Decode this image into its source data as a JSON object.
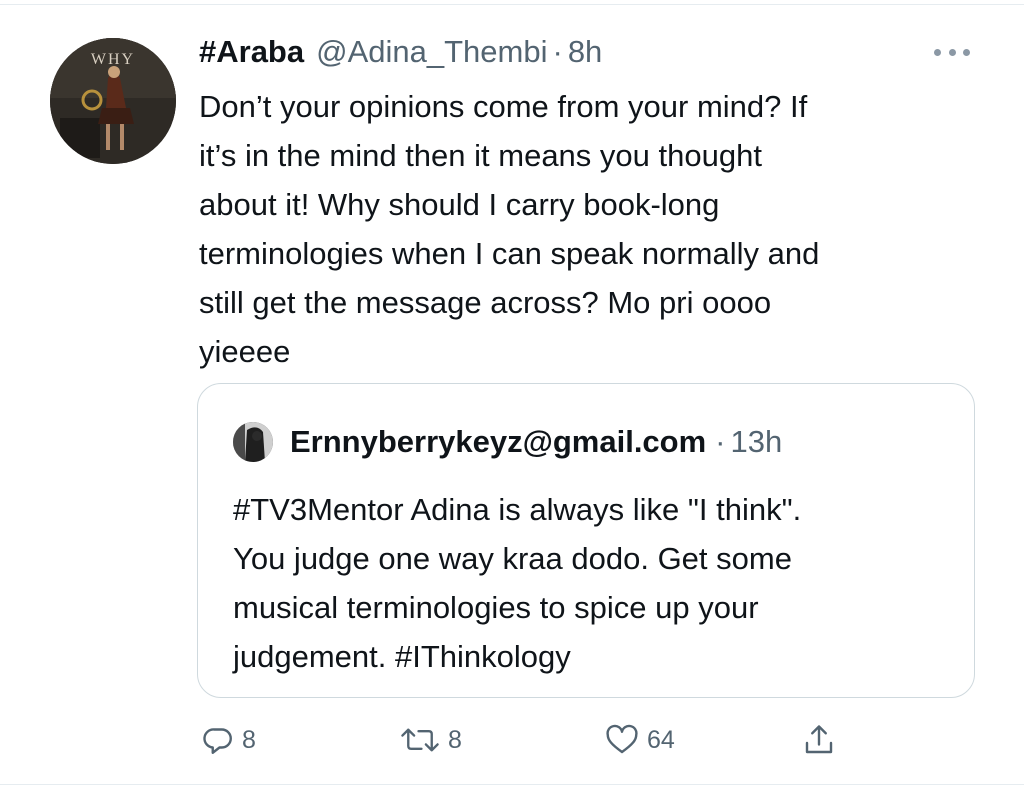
{
  "tweet": {
    "display_name": "#Araba",
    "handle": "@Adina_Thembi",
    "separator": "·",
    "time": "8h",
    "more_icon": "more-horizontal-icon",
    "avatar_text": "WHY",
    "text_lines": [
      "Don’t your opinions come from your mind? If",
      "it’s in the mind then it means you thought",
      "about it! Why should I carry book-long",
      "terminologies when I can speak normally and",
      "still get the message across? Mo pri oooo",
      "yieeee"
    ]
  },
  "quoted_tweet": {
    "display_name": "Ernnyberrykeyz@gmail.com",
    "separator": "·",
    "time": "13h",
    "text_lines": [
      "#TV3Mentor Adina is always like \"I think\".",
      "You judge one way kraa dodo. Get some",
      "musical terminologies to spice up your",
      "judgement. #IThinkology"
    ]
  },
  "actions": {
    "reply_count": "8",
    "retweet_count": "8",
    "like_count": "64",
    "icons": [
      "reply-icon",
      "retweet-icon",
      "like-icon",
      "share-icon"
    ]
  },
  "colors": {
    "text": "#0f1419",
    "secondary": "#536471",
    "border": "#cfd9de"
  }
}
